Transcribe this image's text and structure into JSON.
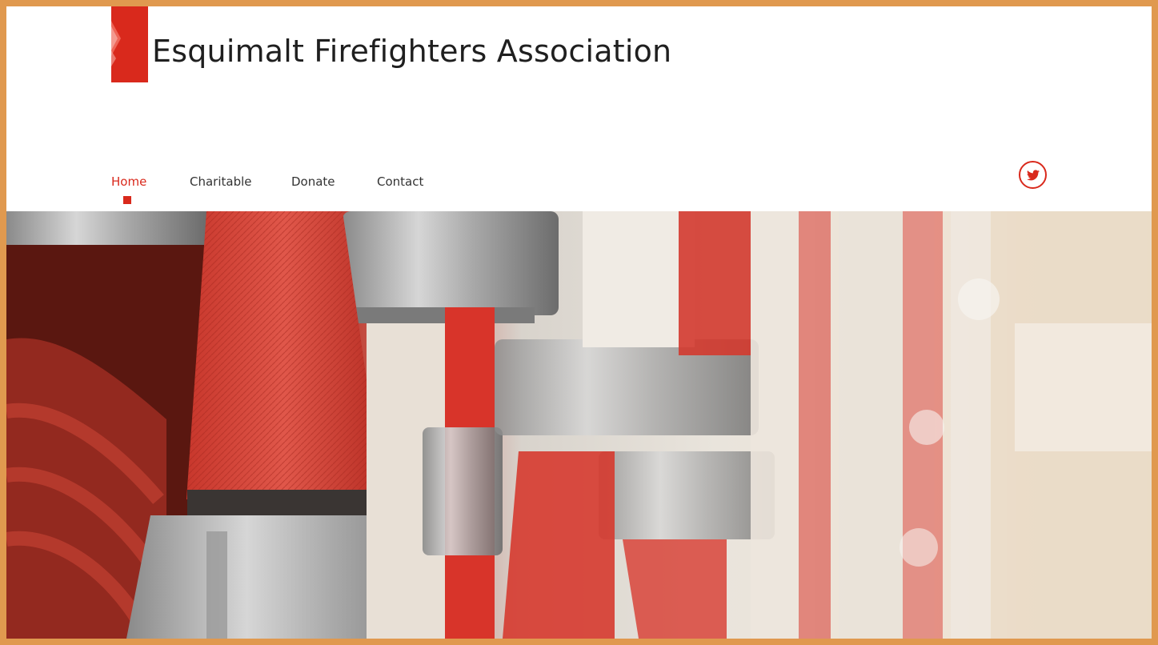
{
  "site": {
    "title": "Esquimalt Firefighters Association",
    "brand_color": "#d9291c",
    "frame_color": "#e0994f"
  },
  "nav": {
    "items": [
      {
        "label": "Home",
        "active": true
      },
      {
        "label": "Charitable",
        "active": false
      },
      {
        "label": "Donate",
        "active": false
      },
      {
        "label": "Contact",
        "active": false
      }
    ]
  },
  "social": {
    "twitter_icon": "twitter-icon"
  },
  "hero": {
    "image": "fire-hose-nozzles-photo"
  }
}
